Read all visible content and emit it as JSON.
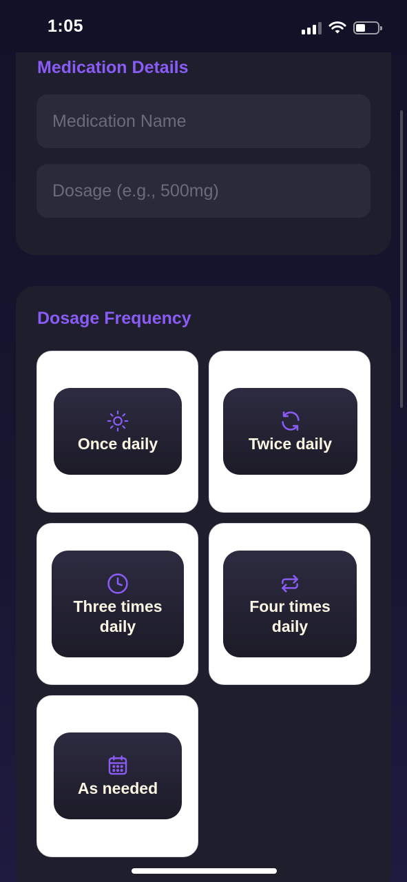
{
  "status_bar": {
    "time": "1:05",
    "icons": [
      "cellular-signal-icon",
      "wifi-icon",
      "battery-icon"
    ]
  },
  "medication_details": {
    "title": "Medication Details",
    "name_placeholder": "Medication Name",
    "name_value": "",
    "dosage_placeholder": "Dosage (e.g., 500mg)",
    "dosage_value": ""
  },
  "dosage_frequency": {
    "title": "Dosage Frequency",
    "options": [
      {
        "label": "Once daily",
        "icon": "sun-icon"
      },
      {
        "label": "Twice daily",
        "icon": "refresh-icon"
      },
      {
        "label": "Three times daily",
        "icon": "clock-icon"
      },
      {
        "label": "Four times daily",
        "icon": "repeat-icon"
      },
      {
        "label": "As needed",
        "icon": "calendar-icon"
      }
    ]
  },
  "colors": {
    "accent": "#8a5cf6",
    "card_background": "#1e1e2c",
    "input_background": "#2b2a3b",
    "tile_background": "#ffffff",
    "tile_label": "#fbf6e4"
  }
}
